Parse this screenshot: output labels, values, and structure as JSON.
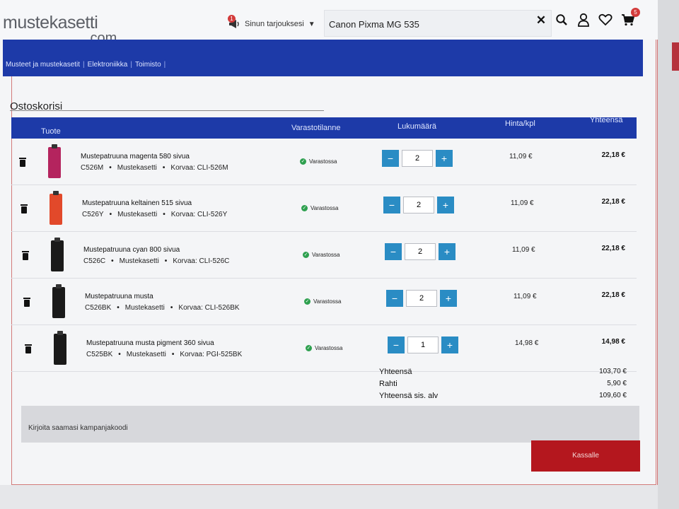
{
  "brand": {
    "logo_line1": "mustekasetti",
    "logo_line2": ".com",
    "stripe_colors": [
      "#3b67c9",
      "#e23b54",
      "#f08e2a",
      "#f4d03f",
      "#2aa7a0",
      "#8ac540",
      "#9aa0a8"
    ]
  },
  "header": {
    "offers_label": "Sinun tarjouksesi",
    "offers_badge": "1",
    "search_value": "Canon Pixma MG 535",
    "cart_badge": "5"
  },
  "nav": {
    "items": [
      "Musteet ja mustekasetit",
      "Elektroniikka",
      "Toimisto"
    ]
  },
  "cart": {
    "title": "Ostoskorisi",
    "headers": {
      "product": "Tuote",
      "stock": "Varastotilanne",
      "quantity": "Lukumäärä",
      "unit_price": "Hinta/kpl",
      "total": "Yhteensä"
    },
    "items": [
      {
        "name": "Mustepatruuna magenta 580 sivua",
        "code": "C526M",
        "brand": "Mustekasetti",
        "replaces": "Korvaa: CLI-526M",
        "stock": "Varastossa",
        "qty": "2",
        "unit_price": "11,09 €",
        "total": "22,18 €",
        "color": "#b4245e"
      },
      {
        "name": "Mustepatruuna keltainen 515 sivua",
        "code": "C526Y",
        "brand": "Mustekasetti",
        "replaces": "Korvaa: CLI-526Y",
        "stock": "Varastossa",
        "qty": "2",
        "unit_price": "11,09 €",
        "total": "22,18 €",
        "color": "#e2492a"
      },
      {
        "name": "Mustepatruuna cyan 800 sivua",
        "code": "C526C",
        "brand": "Mustekasetti",
        "replaces": "Korvaa: CLI-526C",
        "stock": "Varastossa",
        "qty": "2",
        "unit_price": "11,09 €",
        "total": "22,18 €",
        "color": "#1a1a1a"
      },
      {
        "name": "Mustepatruuna musta",
        "code": "C526BK",
        "brand": "Mustekasetti",
        "replaces": "Korvaa: CLI-526BK",
        "stock": "Varastossa",
        "qty": "2",
        "unit_price": "11,09 €",
        "total": "22,18 €",
        "color": "#1a1a1a"
      },
      {
        "name": "Mustepatruuna musta pigment 360 sivua",
        "code": "C525BK",
        "brand": "Mustekasetti",
        "replaces": "Korvaa: PGI-525BK",
        "stock": "Varastossa",
        "qty": "1",
        "unit_price": "14,98 €",
        "total": "14,98 €",
        "color": "#1a1a1a"
      }
    ],
    "summary": [
      {
        "label": "Yhteensä",
        "value": "103,70 €"
      },
      {
        "label": "Rahti",
        "value": "5,90 €"
      },
      {
        "label": "Yhteensä sis. alv",
        "value": "109,60 €"
      }
    ],
    "campaign_placeholder": "Kirjoita saamasi kampanjakoodi",
    "checkout_label": "Kassalle"
  }
}
